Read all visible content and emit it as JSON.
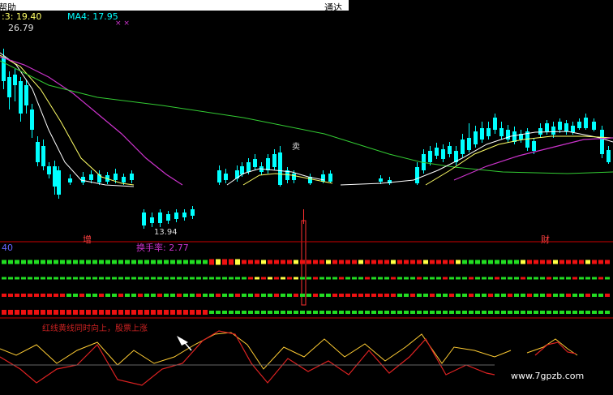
{
  "header": {
    "title_fragment": "帮助",
    "right_fragment": "通达"
  },
  "indicators": {
    "ma_fragment": ":3: 19.40",
    "ma4": "MA4: 17.95",
    "marks": "× ×",
    "high_value": "26.79",
    "low_value": "13.94",
    "sell_label": "卖",
    "tag_zeng": "增",
    "tag_cai": "财",
    "turnover_left": "40",
    "turnover": "换手率: 2.77",
    "strategy_text": "红线黄线同时向上，股票上涨",
    "watermark": "www.7gpzb.com"
  },
  "colors": {
    "up": "#ff3030",
    "down": "#00ffff",
    "ma_white": "#ffffff",
    "ma_yellow": "#ffff66",
    "ma_purple": "#cc33cc",
    "ma_green": "#33cc33",
    "bar_green": "#22dd22",
    "bar_red": "#ee1111",
    "bar_yellow": "#ffff44",
    "osc_yellow": "#ffcc33",
    "osc_red": "#dd2222",
    "divider": "#cc0000"
  },
  "chart_data": [
    {
      "type": "candlestick",
      "title": "",
      "annotations": [
        "26.79",
        "13.94",
        "卖",
        "MA4: 17.95"
      ],
      "series": [
        {
          "name": "MA4",
          "value": 17.95
        }
      ]
    },
    {
      "type": "bar",
      "title": "换手率: 2.77",
      "rows": 4
    },
    {
      "type": "line",
      "title": "红线黄线同时向上，股票上涨",
      "series": [
        "yellow line",
        "red line"
      ]
    }
  ]
}
